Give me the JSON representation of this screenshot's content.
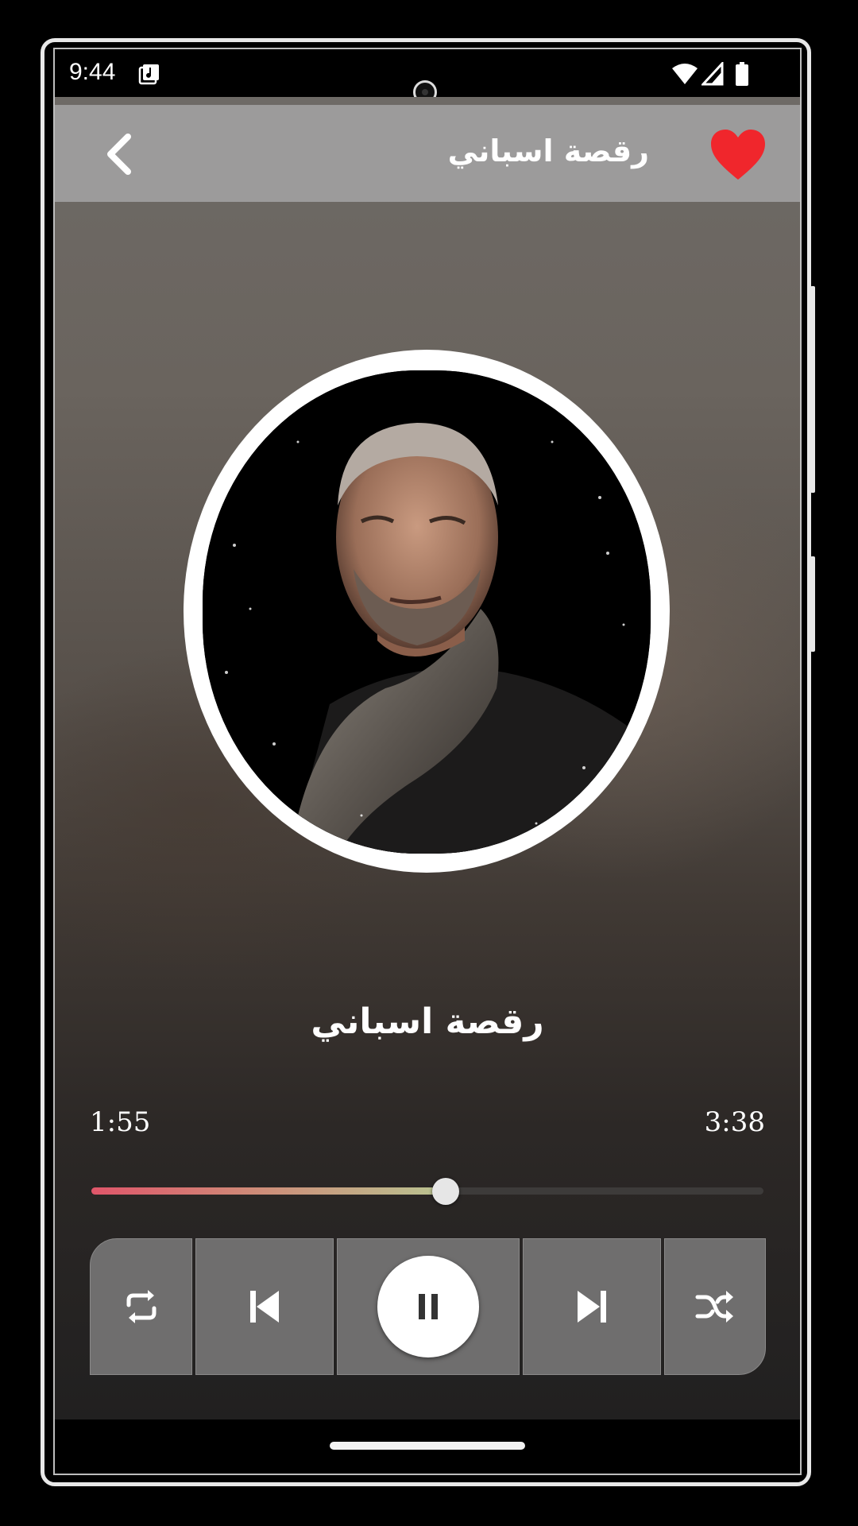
{
  "status_bar": {
    "time": "9:44",
    "icons": [
      "music-notification-icon",
      "wifi-icon",
      "signal-icon",
      "battery-icon"
    ]
  },
  "header": {
    "title": "رقصة اسباني",
    "back_icon": "chevron-left-icon",
    "favorite_icon": "heart-icon",
    "favorite_color": "#f0262c"
  },
  "player": {
    "song_title": "رقصة اسباني",
    "current_time": "1:55",
    "total_time": "3:38",
    "progress_fraction": 0.527
  },
  "controls": [
    "repeat-icon",
    "skip-previous-icon",
    "pause-icon",
    "skip-next-icon",
    "shuffle-icon"
  ],
  "colors": {
    "topbar": "#9c9b9b",
    "progress_start": "#e0566a",
    "progress_end": "#b9c491",
    "control_bg": "#6f6e6e"
  }
}
